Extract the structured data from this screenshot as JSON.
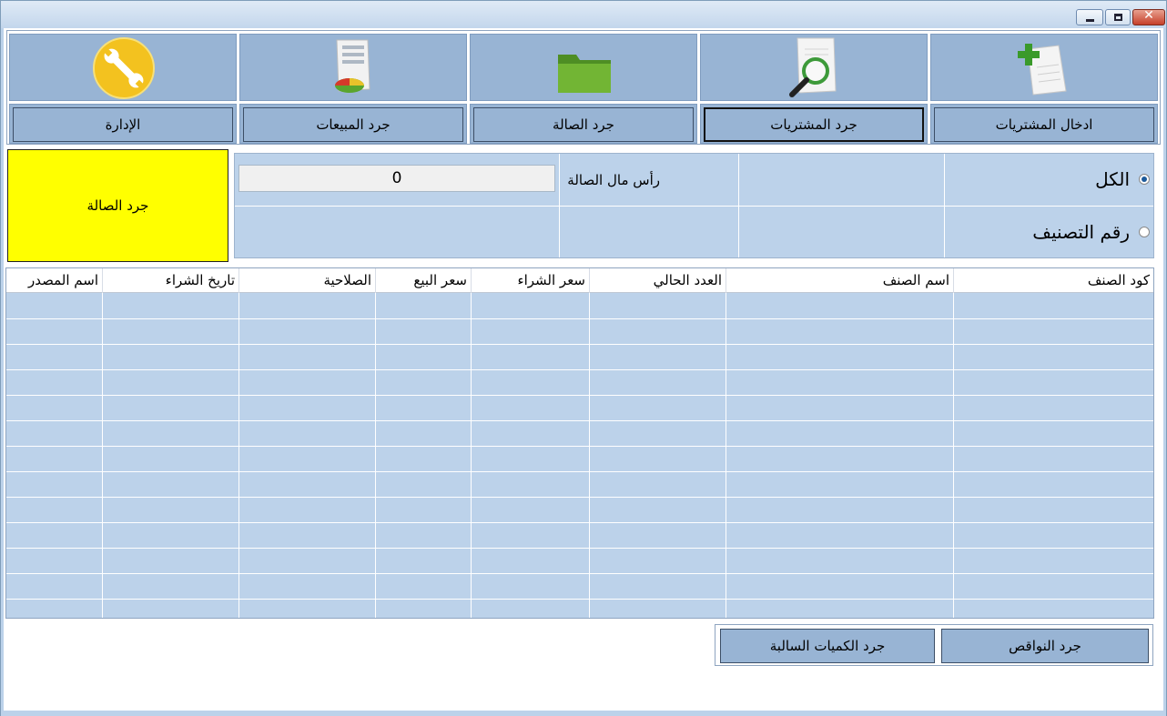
{
  "window": {
    "close_glyph": "✕"
  },
  "toolbar": {
    "items": [
      {
        "label": "ادخال المشتريات",
        "icon": "add-document-icon"
      },
      {
        "label": "جرد المشتريات",
        "icon": "magnifier-document-icon"
      },
      {
        "label": "جرد الصالة",
        "icon": "folder-icon"
      },
      {
        "label": "جرد المبيعات",
        "icon": "report-chart-icon"
      },
      {
        "label": "الإدارة",
        "icon": "wrench-icon"
      }
    ],
    "active_index": 1
  },
  "summary": {
    "title": "جرد الصالة"
  },
  "filter": {
    "capital_label": "رأس مال الصالة",
    "capital_value": "0",
    "options": [
      {
        "label": "الكل",
        "selected": true
      },
      {
        "label": "رقم التصنيف",
        "selected": false
      }
    ]
  },
  "grid": {
    "columns": [
      "كود الصنف",
      "اسم الصنف",
      "العدد الحالي",
      "سعر الشراء",
      "سعر البيع",
      "الصلاحية",
      "تاريخ الشراء",
      "اسم المصدر"
    ],
    "rows": []
  },
  "actions": {
    "shortages_label": "جرد النواقص",
    "negative_qty_label": "جرد الكميات السالبة"
  },
  "colors": {
    "panel_bg": "#bcd2ea",
    "button_bg": "#98b4d4",
    "highlight": "#ffff00"
  }
}
